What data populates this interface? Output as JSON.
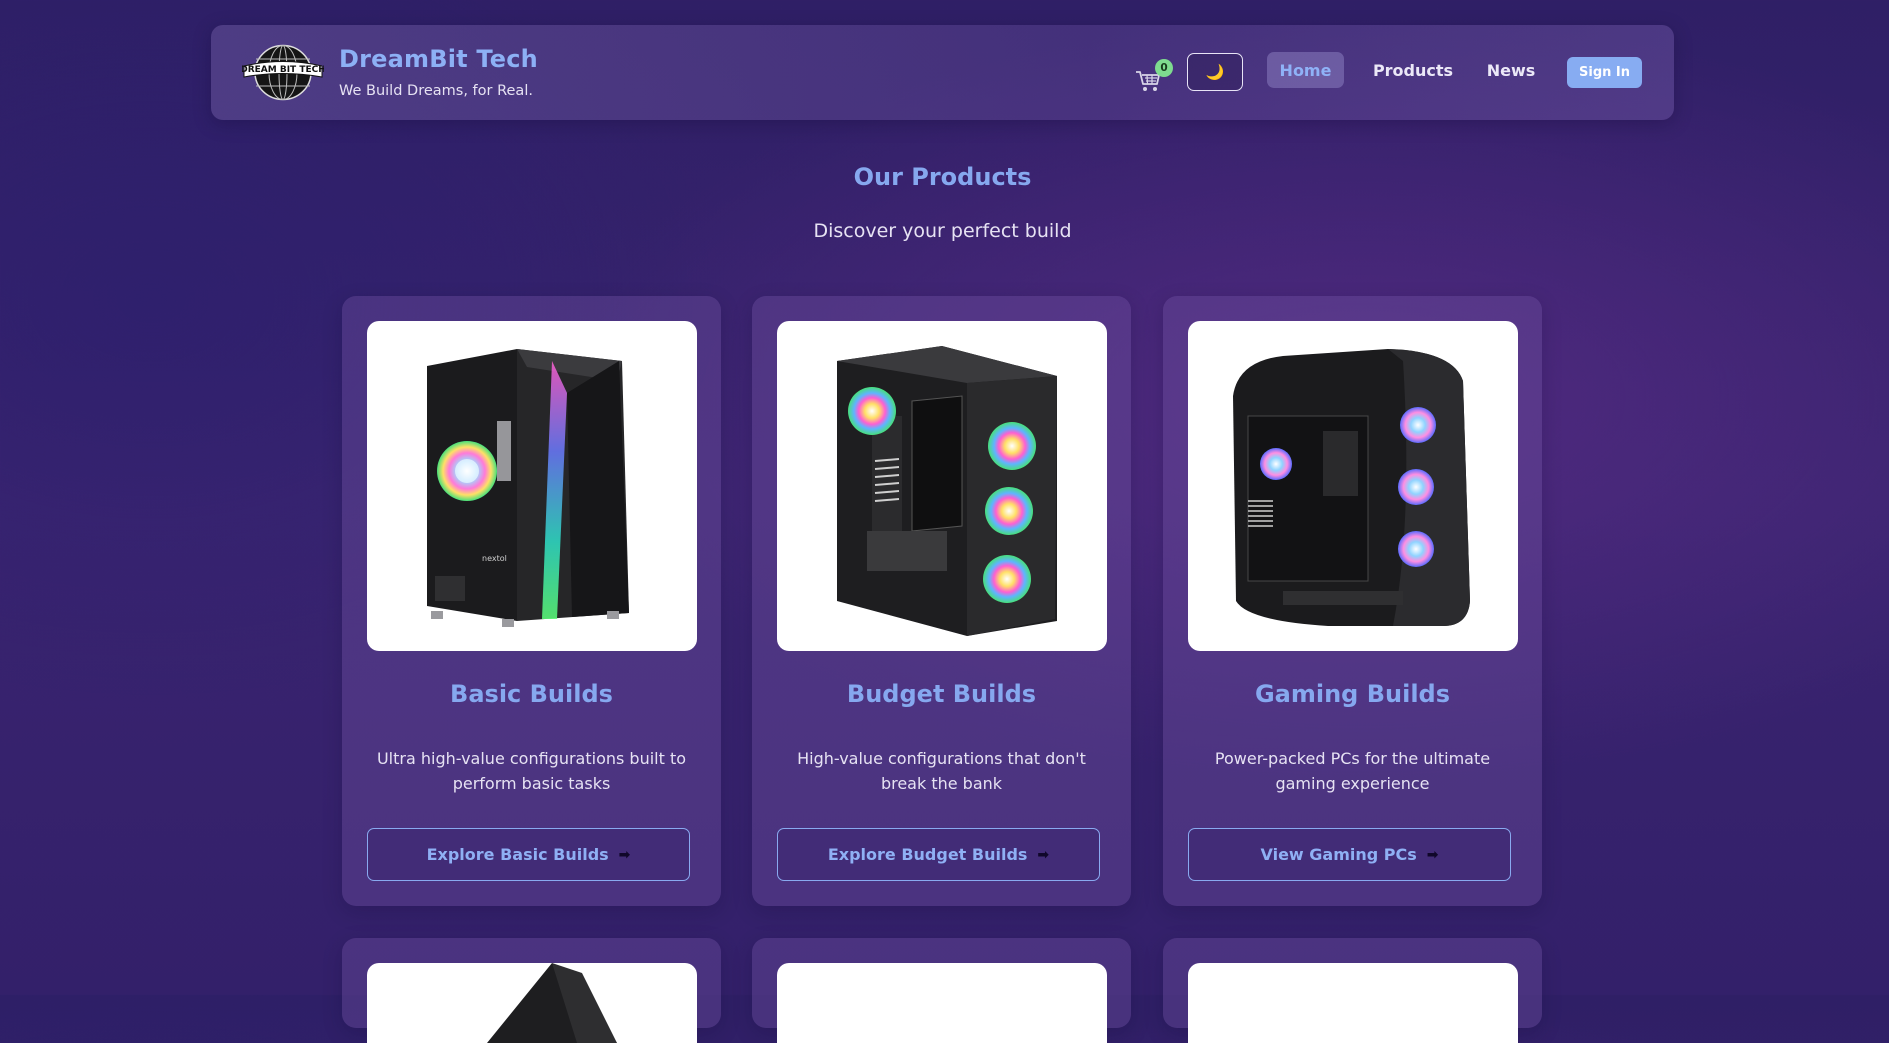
{
  "header": {
    "logo_text": "DREAM BIT TECH",
    "brand_name": "DreamBit Tech",
    "tagline": "We Build Dreams, for Real.",
    "cart_count": "0",
    "theme_toggle_icon": "🌙",
    "nav": [
      {
        "label": "Home",
        "active": true
      },
      {
        "label": "Products",
        "active": false
      },
      {
        "label": "News",
        "active": false
      }
    ],
    "sign_in_label": "Sign In"
  },
  "main": {
    "title": "Our Products",
    "subtitle": "Discover your perfect build",
    "products": [
      {
        "title": "Basic Builds",
        "description": "Ultra high-value configurations built to perform basic tasks",
        "button_label": "Explore Basic Builds",
        "image": "pc-case-basic-image"
      },
      {
        "title": "Budget Builds",
        "description": "High-value configurations that don't break the bank",
        "button_label": "Explore Budget Builds",
        "image": "pc-case-budget-image"
      },
      {
        "title": "Gaming Builds",
        "description": "Power-packed PCs for the ultimate gaming experience",
        "button_label": "View Gaming PCs",
        "image": "pc-case-gaming-image"
      }
    ],
    "arrow_icon": "➡"
  },
  "colors": {
    "accent": "#86a8ef",
    "background": "#331f6a",
    "badge": "#7edb8f",
    "sign_in_bg": "#87acf2"
  }
}
